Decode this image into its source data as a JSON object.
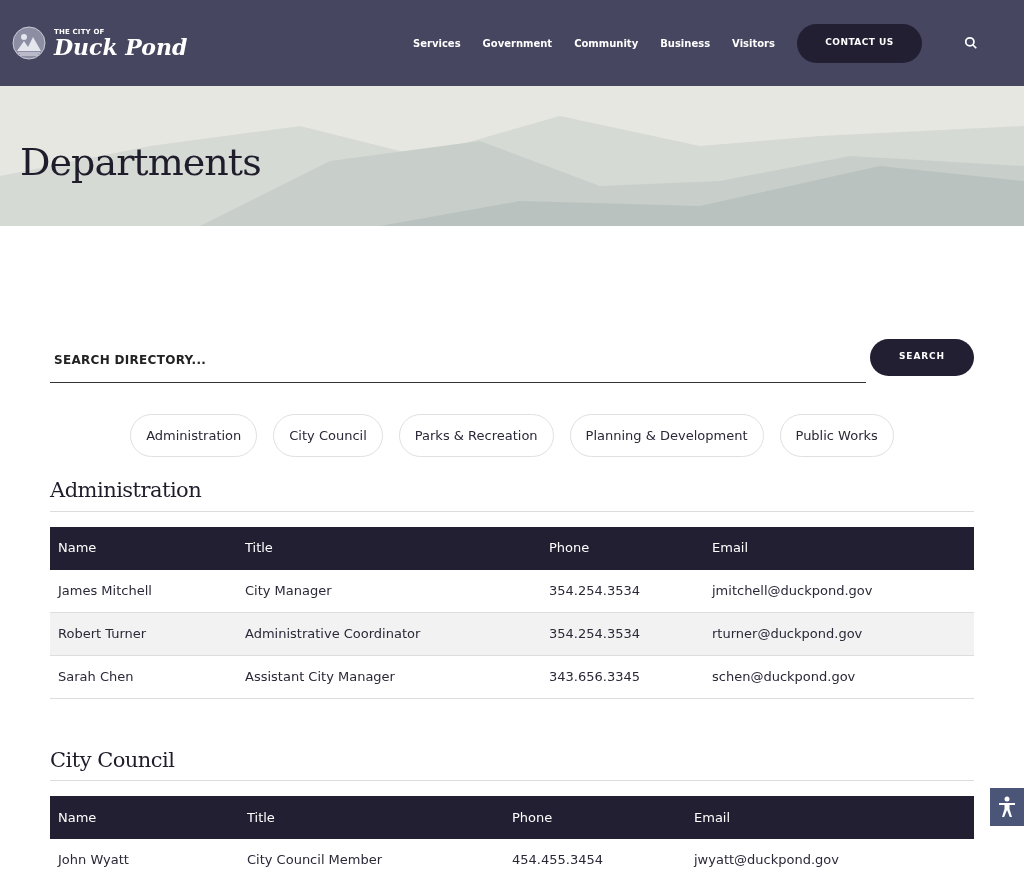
{
  "header": {
    "logo_small": "THE CITY OF",
    "logo_name": "Duck Pond",
    "nav": [
      "Services",
      "Government",
      "Community",
      "Business",
      "Visitors"
    ],
    "contact_button": "CONTACT US"
  },
  "hero": {
    "title": "Departments"
  },
  "search": {
    "placeholder": "SEARCH DIRECTORY...",
    "button": "SEARCH"
  },
  "filters": [
    "Administration",
    "City Council",
    "Parks & Recreation",
    "Planning & Development",
    "Public Works"
  ],
  "sections": [
    {
      "title": "Administration",
      "columns": [
        "Name",
        "Title",
        "Phone",
        "Email"
      ],
      "rows": [
        [
          "James Mitchell",
          "City Manager",
          "354.254.3534",
          "jmitchell@duckpond.gov"
        ],
        [
          "Robert Turner",
          "Administrative Coordinator",
          "354.254.3534",
          "rturner@duckpond.gov"
        ],
        [
          "Sarah Chen",
          "Assistant City Manager",
          "343.656.3345",
          "schen@duckpond.gov"
        ]
      ]
    },
    {
      "title": "City Council",
      "columns": [
        "Name",
        "Title",
        "Phone",
        "Email"
      ],
      "rows": [
        [
          "John Wyatt",
          "City Council Member",
          "454.455.3454",
          "jwyatt@duckpond.gov"
        ]
      ]
    }
  ]
}
